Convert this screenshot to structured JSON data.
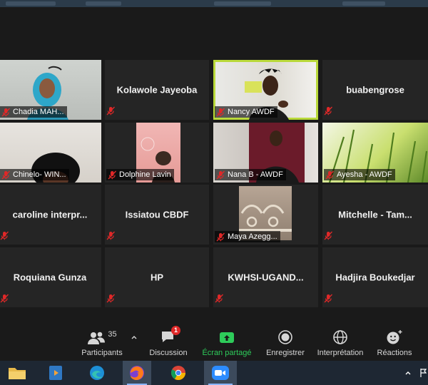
{
  "participants": [
    {
      "name": "Chadia MAH...",
      "video": true
    },
    {
      "name": "Kolawole Jayeoba",
      "video": false
    },
    {
      "name": "Nancy AWDF",
      "video": true,
      "speaking": true
    },
    {
      "name": "buabengrose",
      "video": false
    },
    {
      "name": "Chinelo- WIN...",
      "video": true
    },
    {
      "name": "Dolphine Lavin",
      "video": true
    },
    {
      "name": "Nana B - AWDF",
      "video": true
    },
    {
      "name": "Ayesha - AWDF",
      "video": true
    },
    {
      "name": "caroline  interpr...",
      "video": false
    },
    {
      "name": "Issiatou  CBDF",
      "video": false
    },
    {
      "name": "Maya Azegg...",
      "video": true
    },
    {
      "name": "Mitchelle - Tam...",
      "video": false
    },
    {
      "name": "Roquiana Gunza",
      "video": false
    },
    {
      "name": "HP",
      "video": false
    },
    {
      "name": "KWHSI-UGAND...",
      "video": false
    },
    {
      "name": "Hadjira Boukedjar",
      "video": false
    }
  ],
  "toolbar": {
    "participants_count": "35",
    "participants_label": "Participants",
    "chat_label": "Discussion",
    "chat_badge": "1",
    "share_label": "Écran partagé",
    "record_label": "Enregistrer",
    "interpretation_label": "Interprétation",
    "reactions_label": "Réactions"
  },
  "colors": {
    "speaking_border": "#b9d93a",
    "share_green": "#2ecb5a",
    "mute_red": "#e02828",
    "badge_red": "#e02828"
  },
  "taskbar": {
    "apps": [
      "file-explorer",
      "media-player",
      "edge",
      "firefox",
      "chrome",
      "zoom"
    ]
  }
}
